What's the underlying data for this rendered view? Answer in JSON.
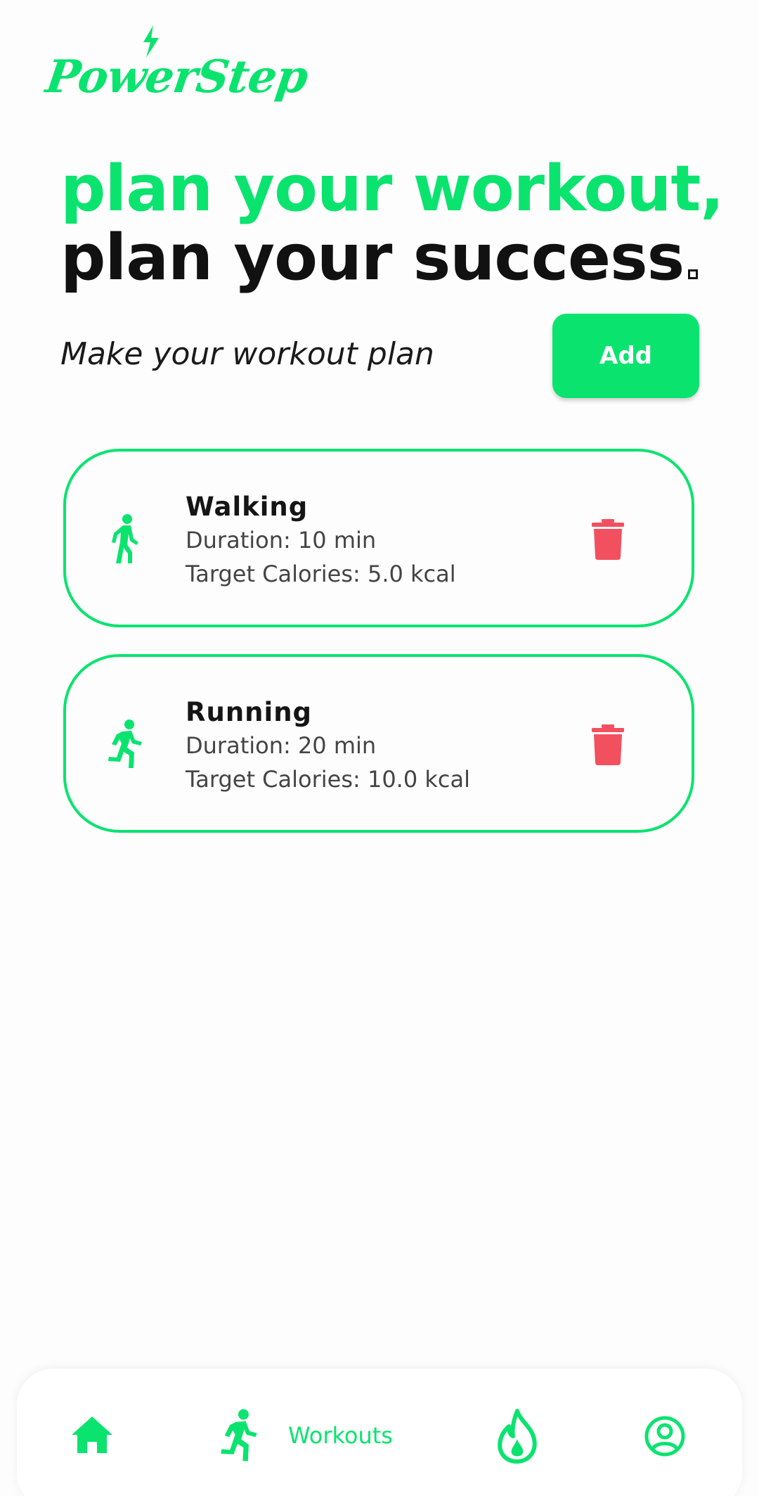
{
  "app": {
    "logo_text": "PowerStep"
  },
  "headline": {
    "line1": "plan your workout,",
    "line2": "plan your success"
  },
  "subtitle": "Make your workout plan",
  "add_label": "Add",
  "workouts": [
    {
      "name": "Walking",
      "duration": "Duration: 10 min",
      "calories": "Target Calories: 5.0 kcal",
      "icon": "walking-icon"
    },
    {
      "name": "Running",
      "duration": "Duration: 20 min",
      "calories": "Target Calories: 10.0 kcal",
      "icon": "running-icon"
    }
  ],
  "nav": {
    "workouts_label": "Workouts",
    "items": [
      "home-icon",
      "running-icon",
      "fire-icon",
      "profile-icon"
    ]
  },
  "colors": {
    "accent": "#0be36f",
    "delete": "#f2505f",
    "text": "#111111"
  }
}
